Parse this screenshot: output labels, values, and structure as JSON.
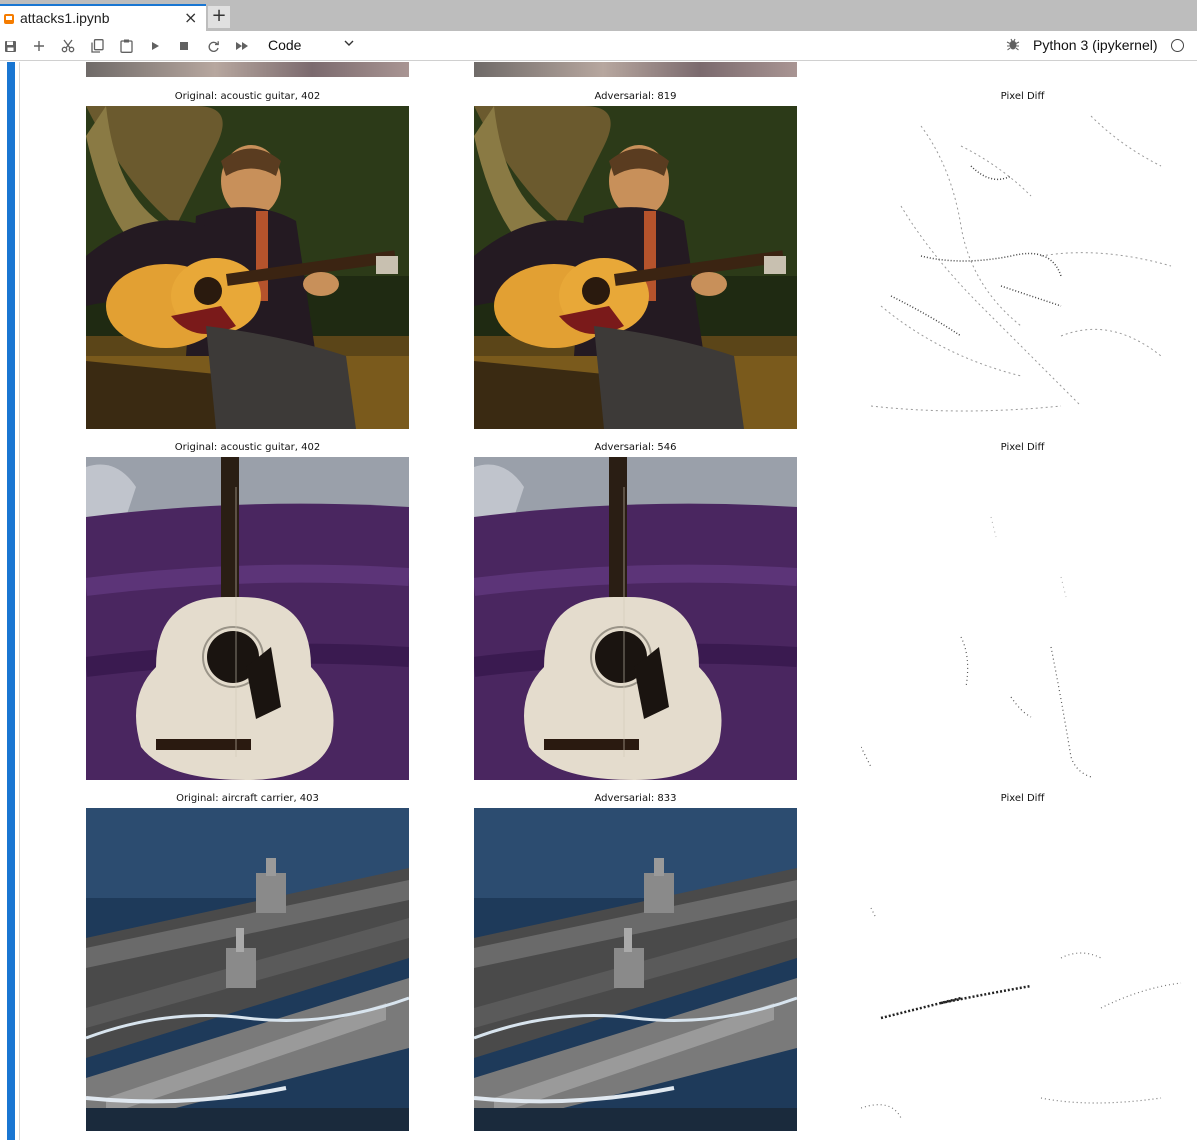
{
  "tab": {
    "title": "attacks1.ipynb",
    "close": "×",
    "add": "+"
  },
  "toolbar": {
    "cell_type": "Code",
    "kernel_name": "Python 3 (ipykernel)"
  },
  "icons": {
    "save": "save-icon",
    "add": "add-cell-icon",
    "cut": "cut-icon",
    "copy": "copy-icon",
    "paste": "paste-icon",
    "run": "run-icon",
    "stop": "stop-icon",
    "restart": "restart-icon",
    "fast_forward": "run-all-icon",
    "chevron": "chevron-down-icon",
    "bug": "debugger-icon",
    "status": "kernel-status-icon",
    "more": "more-icon"
  },
  "colors": {
    "accent": "#1976d2",
    "tab_bg": "#bdbdbd"
  },
  "rows": [
    {
      "original": "Original: acoustic guitar, 402",
      "adversarial": "Adversarial: 819",
      "diff": "Pixel Diff"
    },
    {
      "original": "Original: acoustic guitar, 402",
      "adversarial": "Adversarial: 546",
      "diff": "Pixel Diff"
    },
    {
      "original": "Original: aircraft carrier, 403",
      "adversarial": "Adversarial: 833",
      "diff": "Pixel Diff"
    }
  ]
}
